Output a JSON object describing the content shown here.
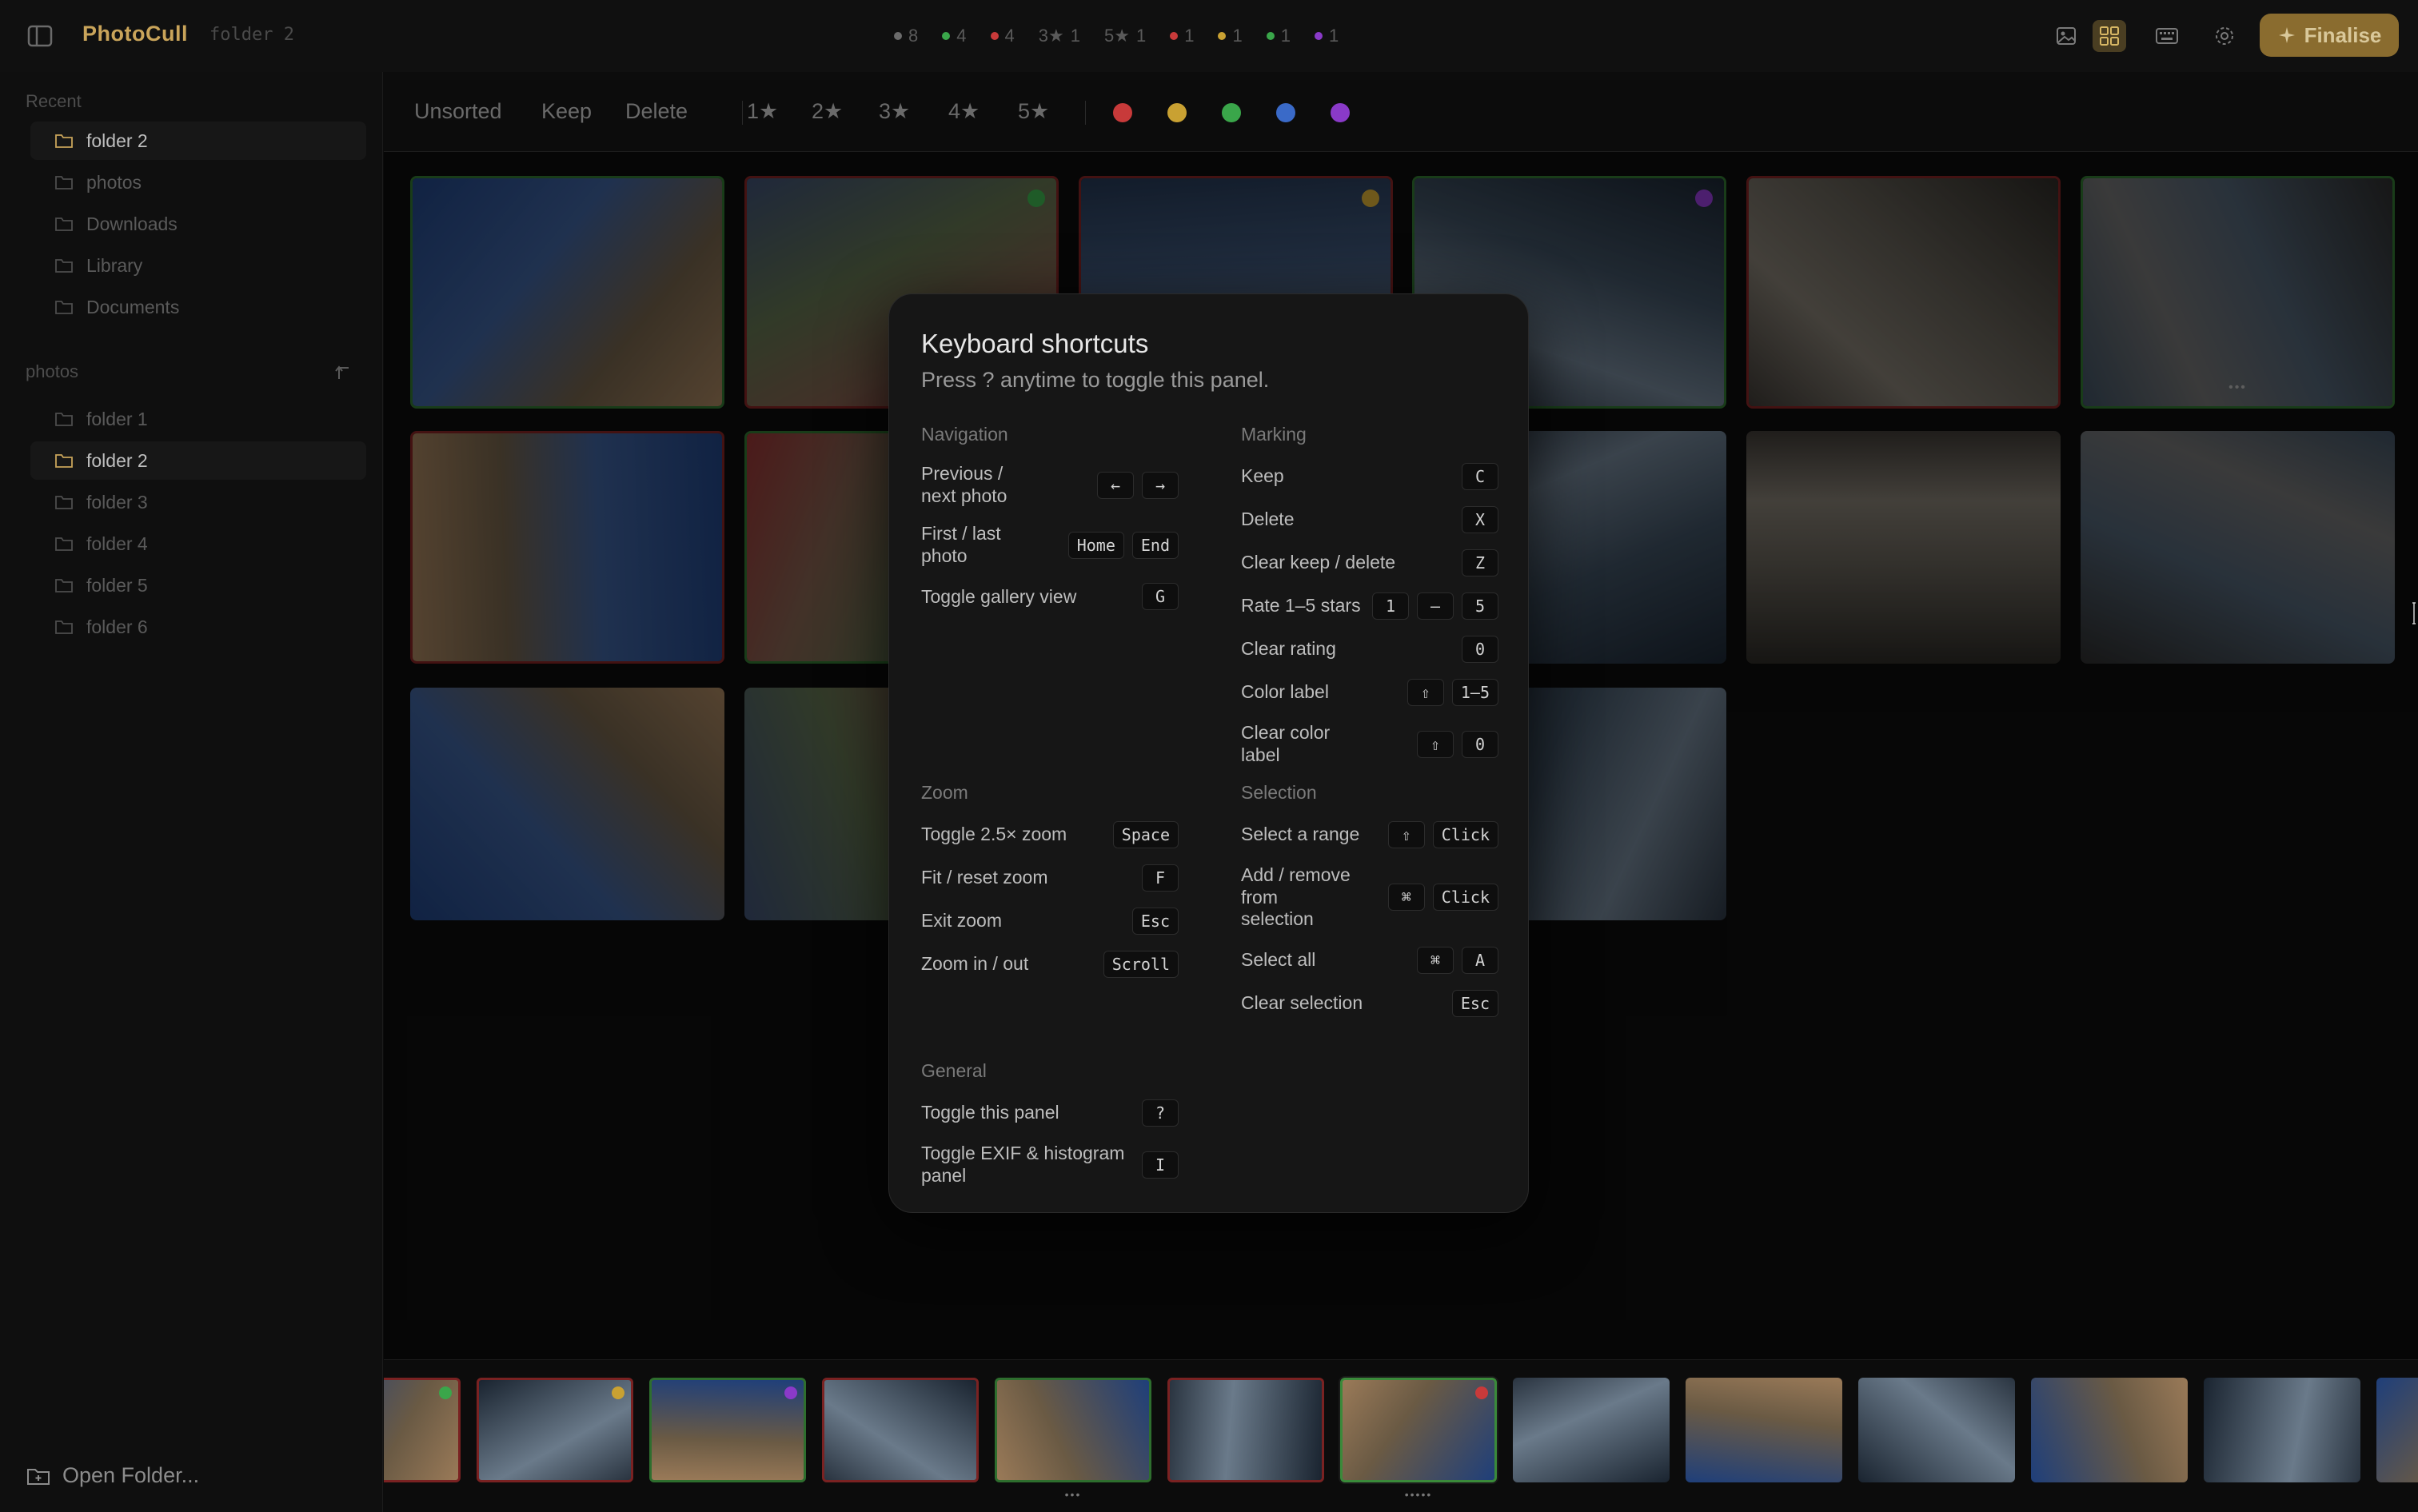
{
  "header": {
    "app_title": "PhotoCull",
    "folder": "folder 2",
    "stats": [
      {
        "kind": "dot",
        "color": "#6b6b6b",
        "count": "8"
      },
      {
        "kind": "dot",
        "color": "#3aa64a",
        "count": "4"
      },
      {
        "kind": "dot",
        "color": "#c83a3a",
        "count": "4"
      },
      {
        "kind": "star",
        "stars": "3★",
        "count": "1"
      },
      {
        "kind": "star",
        "stars": "5★",
        "count": "1"
      },
      {
        "kind": "dot",
        "color": "#c83a3a",
        "count": "1"
      },
      {
        "kind": "dot",
        "color": "#c9a132",
        "count": "1"
      },
      {
        "kind": "dot",
        "color": "#3aa64a",
        "count": "1"
      },
      {
        "kind": "dot",
        "color": "#8a3ac8",
        "count": "1"
      }
    ],
    "icons": [
      "single-view-icon",
      "gallery-view-icon",
      "keyboard-icon",
      "gear-icon"
    ],
    "finalise_label": "Finalise"
  },
  "sidebar": {
    "recent_heading": "Recent",
    "recent": [
      "folder 2",
      "photos",
      "Downloads",
      "Library",
      "Documents"
    ],
    "tree_heading": "photos",
    "tree": [
      "folder 1",
      "folder 2",
      "folder 3",
      "folder 4",
      "folder 5",
      "folder 6"
    ],
    "open_folder_label": "Open Folder..."
  },
  "filters": {
    "status": [
      "Unsorted",
      "Keep",
      "Delete"
    ],
    "ratings": [
      "1★",
      "2★",
      "3★",
      "4★",
      "5★"
    ],
    "colors": [
      "#c83a3a",
      "#c9a132",
      "#3aa64a",
      "#3a6ac8",
      "#8a3ac8"
    ]
  },
  "gallery": [
    {
      "status": "keep",
      "label": ""
    },
    {
      "status": "delete",
      "label": "#3aa64a"
    },
    {
      "status": "delete",
      "label": "#c9a132"
    },
    {
      "status": "keep",
      "label": "#8a3ac8"
    },
    {
      "status": "delete",
      "label": ""
    },
    {
      "status": "keep",
      "label": "",
      "more": true
    },
    {
      "status": "delete",
      "label": ""
    },
    {
      "status": "keep",
      "label": ""
    },
    {
      "status": "",
      "label": ""
    },
    {
      "status": "",
      "label": ""
    },
    {
      "status": "",
      "label": ""
    },
    {
      "status": "",
      "label": ""
    },
    {
      "status": "",
      "label": ""
    },
    {
      "status": "",
      "label": ""
    },
    {
      "status": "",
      "label": ""
    },
    {
      "status": "",
      "label": ""
    }
  ],
  "filmstrip": [
    {
      "status": "delete",
      "label": "#3aa64a"
    },
    {
      "status": "delete",
      "label": "#c9a132"
    },
    {
      "status": "keep",
      "label": "#8a3ac8"
    },
    {
      "status": "delete",
      "label": ""
    },
    {
      "status": "keep",
      "label": "",
      "dots": "•••"
    },
    {
      "status": "delete",
      "label": ""
    },
    {
      "status": "current",
      "label": "#c83a3a",
      "dots": "•••••"
    },
    {
      "status": "",
      "label": ""
    },
    {
      "status": "",
      "label": ""
    },
    {
      "status": "",
      "label": ""
    },
    {
      "status": "",
      "label": ""
    },
    {
      "status": "",
      "label": ""
    },
    {
      "status": "",
      "label": ""
    }
  ],
  "shortcuts": {
    "title": "Keyboard shortcuts",
    "subtitle": "Press ? anytime to toggle this panel.",
    "sections": [
      {
        "heading": "Navigation",
        "rows": [
          {
            "desc": "Previous / next photo",
            "keys": [
              "←",
              "→"
            ]
          },
          {
            "desc": "First / last photo",
            "keys": [
              "Home",
              "End"
            ]
          },
          {
            "desc": "Toggle gallery view",
            "keys": [
              "G"
            ]
          }
        ]
      },
      {
        "heading": "Marking",
        "rows": [
          {
            "desc": "Keep",
            "keys": [
              "C"
            ]
          },
          {
            "desc": "Delete",
            "keys": [
              "X"
            ]
          },
          {
            "desc": "Clear keep / delete",
            "keys": [
              "Z"
            ]
          },
          {
            "desc": "Rate 1–5 stars",
            "keys": [
              "1",
              "–",
              "5"
            ]
          },
          {
            "desc": "Clear rating",
            "keys": [
              "0"
            ]
          },
          {
            "desc": "Color label",
            "keys": [
              "⇧",
              "1–5"
            ]
          },
          {
            "desc": "Clear color label",
            "keys": [
              "⇧",
              "0"
            ]
          }
        ]
      },
      {
        "heading": "Zoom",
        "rows": [
          {
            "desc": "Toggle 2.5× zoom",
            "keys": [
              "Space"
            ]
          },
          {
            "desc": "Fit / reset zoom",
            "keys": [
              "F"
            ]
          },
          {
            "desc": "Exit zoom",
            "keys": [
              "Esc"
            ]
          },
          {
            "desc": "Zoom in / out",
            "keys": [
              "Scroll"
            ]
          }
        ]
      },
      {
        "heading": "Selection",
        "rows": [
          {
            "desc": "Select a range",
            "keys": [
              "⇧",
              "Click"
            ]
          },
          {
            "desc": "Add / remove from selection",
            "keys": [
              "⌘",
              "Click"
            ]
          },
          {
            "desc": "Select all",
            "keys": [
              "⌘",
              "A"
            ]
          },
          {
            "desc": "Clear selection",
            "keys": [
              "Esc"
            ]
          }
        ]
      },
      {
        "heading": "General",
        "rows": [
          {
            "desc": "Toggle this panel",
            "keys": [
              "?"
            ]
          },
          {
            "desc": "Toggle EXIF & histogram panel",
            "keys": [
              "I"
            ]
          }
        ]
      }
    ]
  }
}
